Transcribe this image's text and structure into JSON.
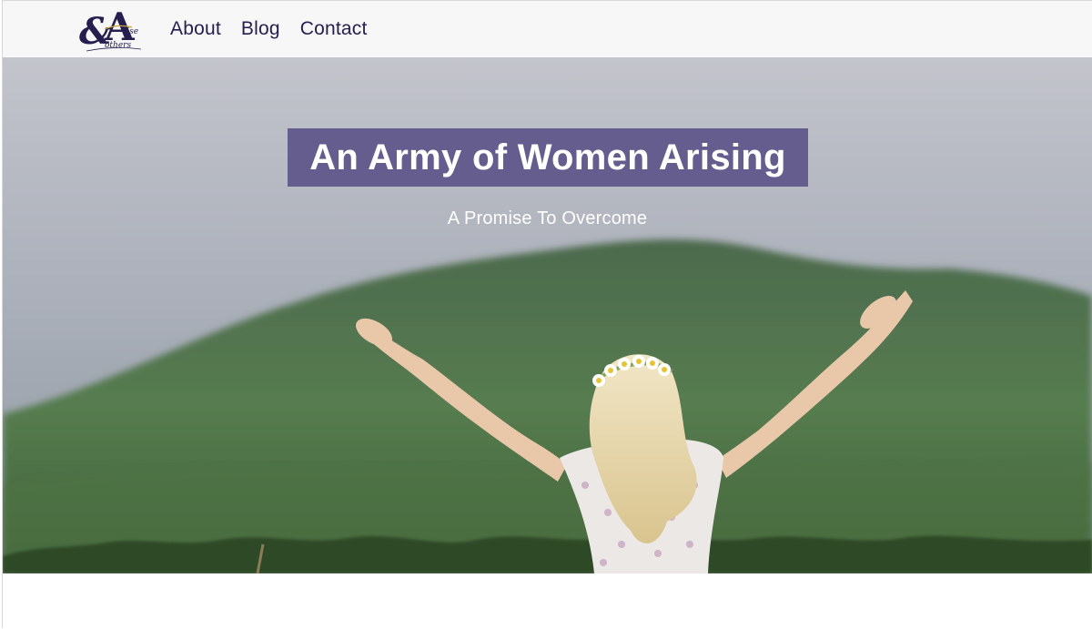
{
  "logo": {
    "letters": "EA",
    "script_text": "of Arise Mothers"
  },
  "nav": {
    "links": [
      {
        "label": "About"
      },
      {
        "label": "Blog"
      },
      {
        "label": "Contact"
      }
    ]
  },
  "hero": {
    "title": "An Army of Women Arising",
    "subtitle": "A Promise To Overcome",
    "title_bg_color": "#655d8e"
  },
  "colors": {
    "nav_text": "#241f4e",
    "logo_gold": "#c9a43a"
  }
}
